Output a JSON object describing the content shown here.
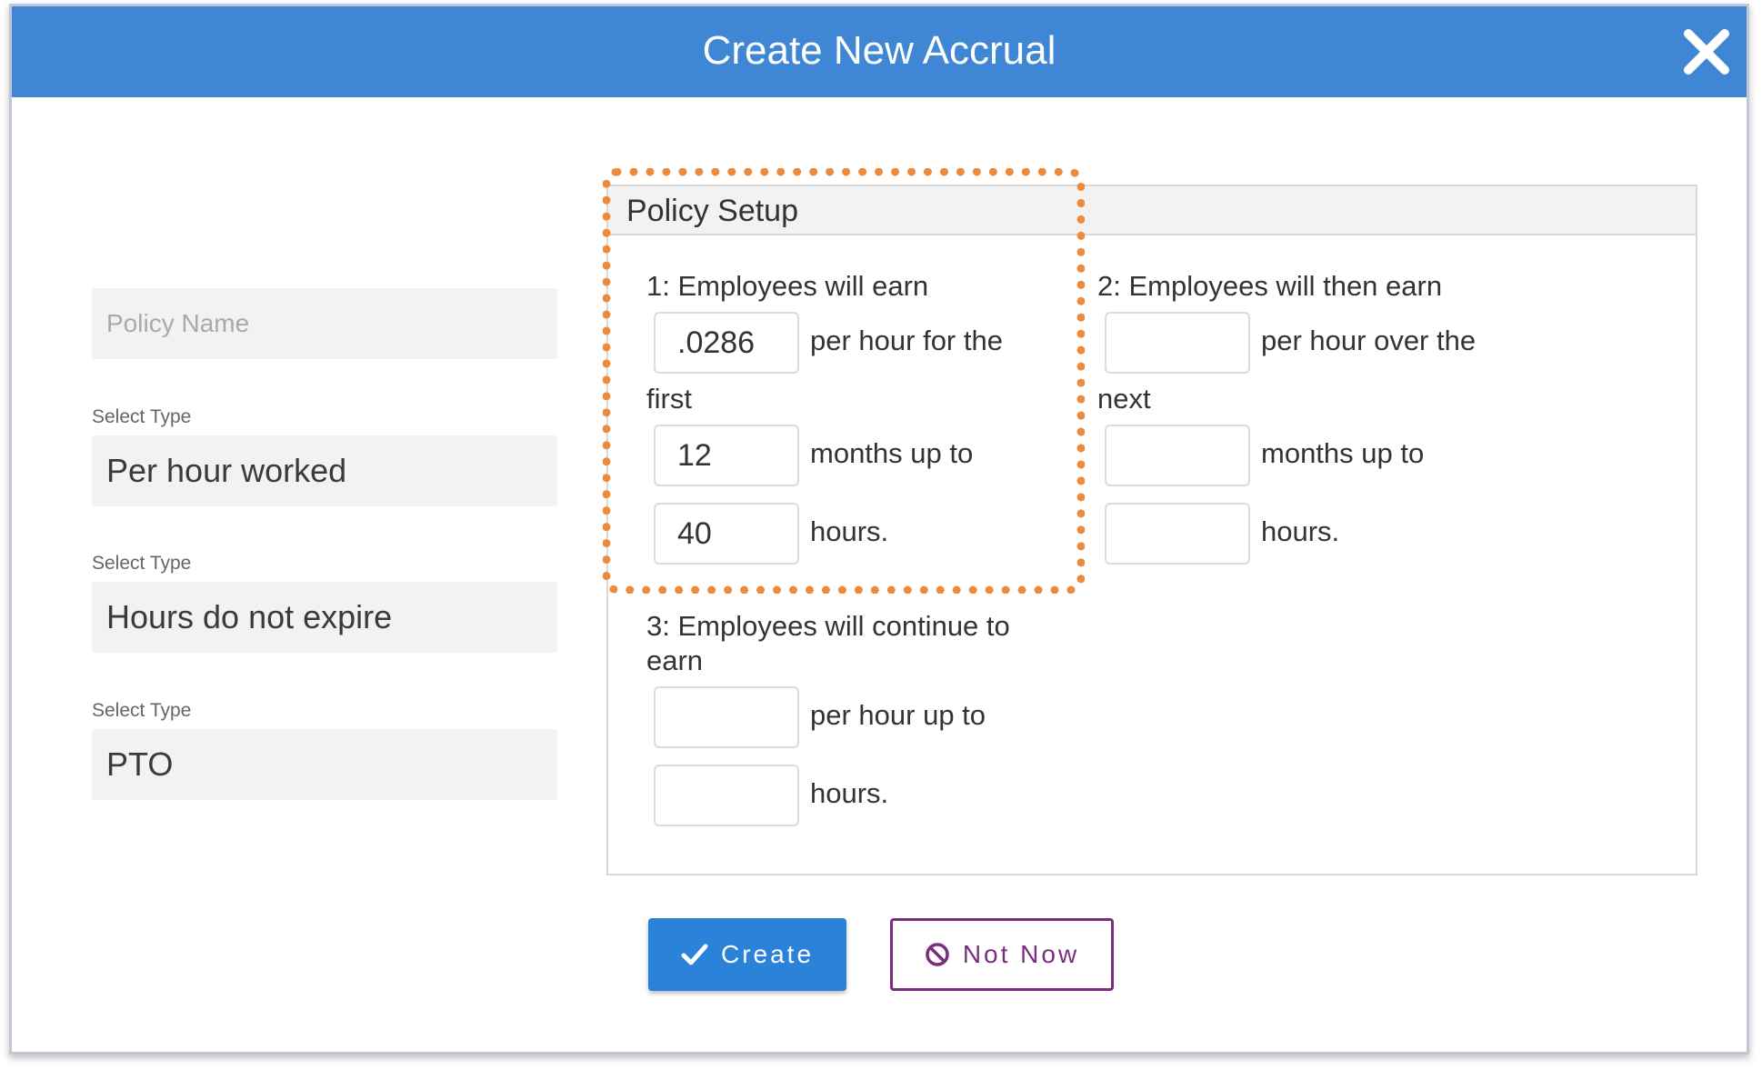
{
  "dialog": {
    "title": "Create New Accrual",
    "close_icon": "close-icon"
  },
  "left": {
    "policy_name_placeholder": "Policy Name",
    "type1_label": "Select Type",
    "type1_value": "Per hour worked",
    "type2_label": "Select Type",
    "type2_value": "Hours do not expire",
    "type3_label": "Select Type",
    "type3_value": "PTO"
  },
  "policy": {
    "title": "Policy Setup",
    "step1": {
      "heading": "1: Employees will earn",
      "rate_value": ".0286",
      "rate_suffix": "per hour for the",
      "rate_wrap": "first",
      "months_value": "12",
      "months_suffix": "months up to",
      "hours_value": "40",
      "hours_suffix": "hours."
    },
    "step2": {
      "heading": "2: Employees will then earn",
      "rate_value": "",
      "rate_suffix": "per hour over the",
      "rate_wrap": "next",
      "months_value": "",
      "months_suffix": "months up to",
      "hours_value": "",
      "hours_suffix": "hours."
    },
    "step3": {
      "heading_line1": "3: Employees will continue to",
      "heading_line2": "earn",
      "rate_value": "",
      "rate_suffix": "per hour up to",
      "hours_value": "",
      "hours_suffix": "hours."
    }
  },
  "buttons": {
    "create_label": "Create",
    "not_now_label": "Not Now"
  },
  "colors": {
    "header": "#3f87d4",
    "highlight": "#ee8a3a",
    "create": "#2b82d9",
    "not_now": "#7b2d7f"
  }
}
